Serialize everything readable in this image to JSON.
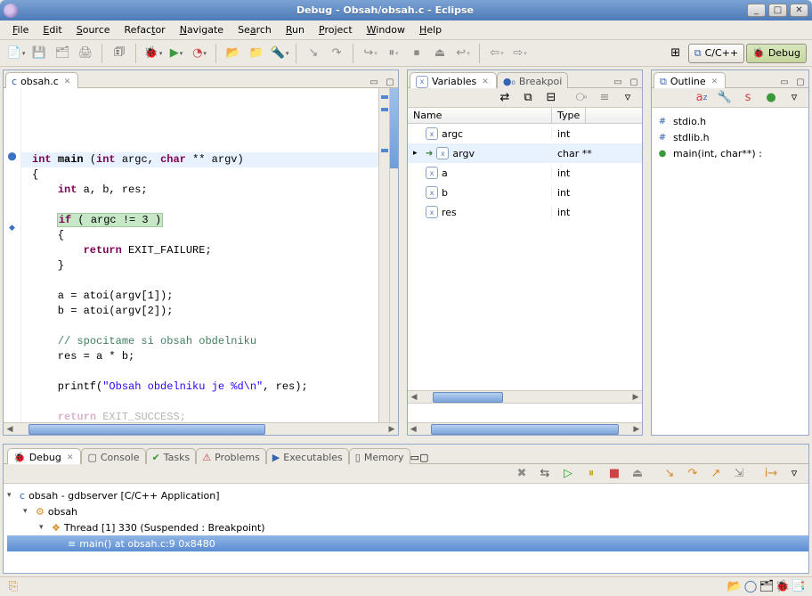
{
  "window": {
    "title": "Debug - Obsah/obsah.c - Eclipse"
  },
  "menubar": [
    "File",
    "Edit",
    "Source",
    "Refactor",
    "Navigate",
    "Search",
    "Run",
    "Project",
    "Window",
    "Help"
  ],
  "perspectives": {
    "cpp": "C/C++",
    "debug": "Debug"
  },
  "editor": {
    "tab": "obsah.c",
    "code_lines": [
      {
        "t": "int main (int argc, char ** argv)",
        "kind": "sig"
      },
      {
        "t": "{",
        "kind": "plain"
      },
      {
        "t": "    int a, b, res;",
        "kind": "decl"
      },
      {
        "t": "",
        "kind": "blank"
      },
      {
        "t": "    if ( argc != 3 )",
        "kind": "hl"
      },
      {
        "t": "    {",
        "kind": "plain"
      },
      {
        "t": "        return EXIT_FAILURE;",
        "kind": "ret"
      },
      {
        "t": "    }",
        "kind": "plain"
      },
      {
        "t": "",
        "kind": "blank"
      },
      {
        "t": "    a = atoi(argv[1]);",
        "kind": "plain"
      },
      {
        "t": "    b = atoi(argv[2]);",
        "kind": "plain"
      },
      {
        "t": "",
        "kind": "blank"
      },
      {
        "t": "    // spocitame si obsah obdelniku",
        "kind": "comment"
      },
      {
        "t": "    res = a * b;",
        "kind": "plain"
      },
      {
        "t": "",
        "kind": "blank"
      },
      {
        "t": "    printf(\"Obsah obdelniku je %d\\n\", res);",
        "kind": "printf"
      },
      {
        "t": "",
        "kind": "blank"
      },
      {
        "t": "    return EXIT_SUCCESS;",
        "kind": "ret-faded"
      }
    ]
  },
  "variables": {
    "tab_vars": "Variables",
    "tab_bp": "Breakpoi",
    "col_name": "Name",
    "col_type": "Type",
    "rows": [
      {
        "name": "argc",
        "type": "int",
        "sel": false,
        "exp": false
      },
      {
        "name": "argv",
        "type": "char **",
        "sel": true,
        "exp": true
      },
      {
        "name": "a",
        "type": "int",
        "sel": false,
        "exp": false
      },
      {
        "name": "b",
        "type": "int",
        "sel": false,
        "exp": false
      },
      {
        "name": "res",
        "type": "int",
        "sel": false,
        "exp": false
      }
    ]
  },
  "outline": {
    "tab": "Outline",
    "items": [
      {
        "icon": "inc",
        "label": "stdio.h"
      },
      {
        "icon": "inc",
        "label": "stdlib.h"
      },
      {
        "icon": "fn",
        "label": "main(int, char**) :"
      }
    ]
  },
  "bottom_tabs": {
    "debug": "Debug",
    "console": "Console",
    "tasks": "Tasks",
    "problems": "Problems",
    "exec": "Executables",
    "memory": "Memory"
  },
  "debug_tree": {
    "root": "obsah - gdbserver [C/C++ Application]",
    "proc": "obsah",
    "thread": "Thread [1] 330 (Suspended : Breakpoint)",
    "frame": "main() at obsah.c:9 0x8480"
  }
}
